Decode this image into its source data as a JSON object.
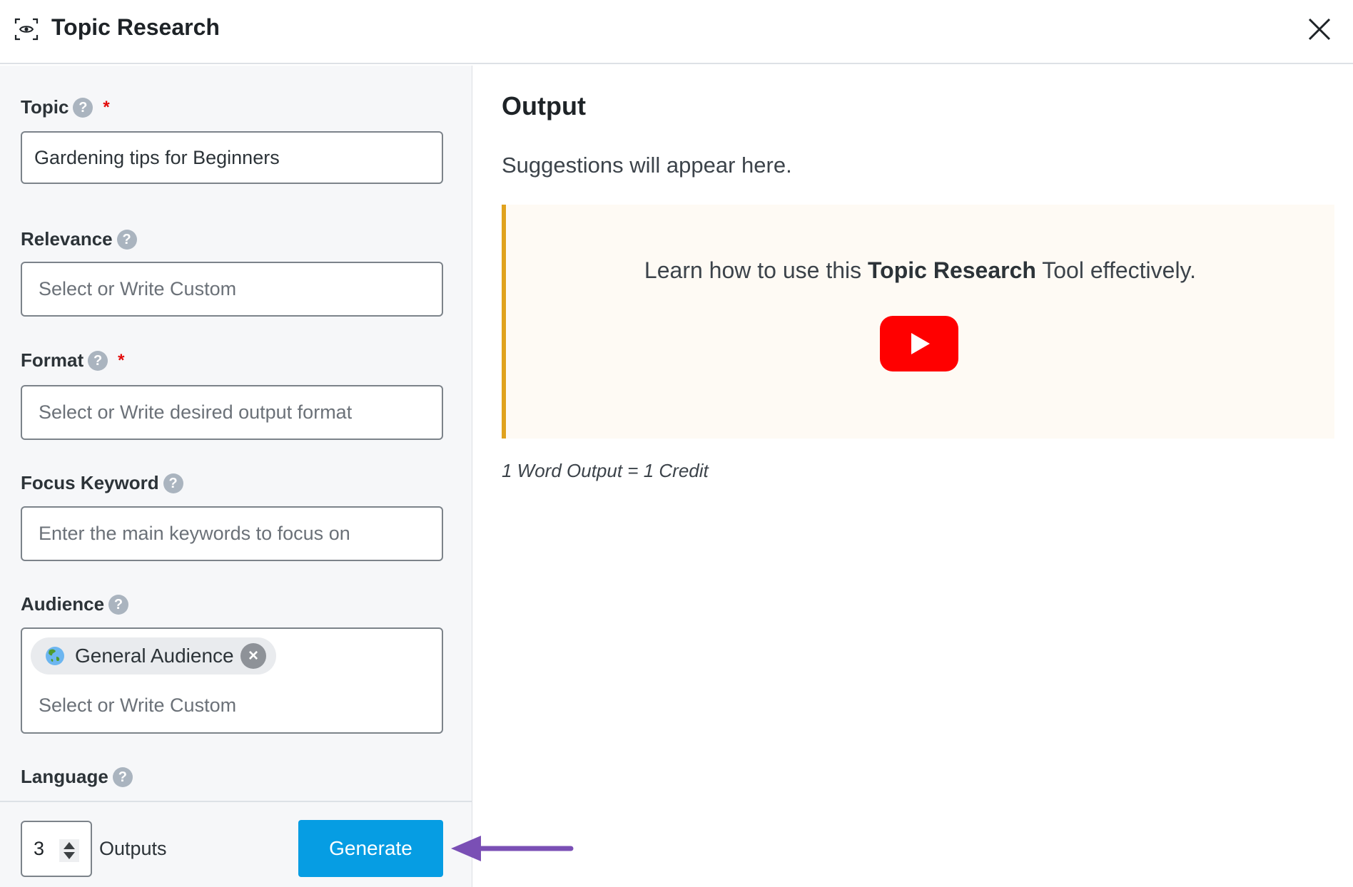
{
  "header": {
    "title": "Topic Research",
    "logo_icon": "eye-scan-icon",
    "close_icon": "close-icon"
  },
  "form": {
    "topic": {
      "label": "Topic",
      "required_mark": "*",
      "value": "Gardening tips for Beginners",
      "help": "?"
    },
    "relevance": {
      "label": "Relevance",
      "placeholder": "Select or Write Custom",
      "help": "?"
    },
    "format": {
      "label": "Format",
      "required_mark": "*",
      "placeholder": "Select or Write desired output format",
      "help": "?"
    },
    "focus_keyword": {
      "label": "Focus Keyword",
      "placeholder": "Enter the main keywords to focus on",
      "help": "?"
    },
    "audience": {
      "label": "Audience",
      "help": "?",
      "chips": [
        {
          "label": "General Audience",
          "icon": "globe-icon",
          "remove": "×"
        }
      ],
      "placeholder": "Select or Write Custom"
    },
    "language": {
      "label": "Language",
      "help": "?"
    }
  },
  "footer": {
    "outputs_value": "3",
    "outputs_label": "Outputs",
    "generate_label": "Generate"
  },
  "output": {
    "title": "Output",
    "suggestions_text": "Suggestions will appear here.",
    "callout": {
      "prefix": "Learn how to use this ",
      "bold": "Topic Research",
      "suffix": " Tool effectively.",
      "video_icon": "youtube-play-icon"
    },
    "credit_note": "1 Word Output = 1 Credit"
  },
  "colors": {
    "accent_button": "#069de3",
    "callout_border": "#e0a21d",
    "callout_bg": "#fefaf4",
    "required": "#e30b0b",
    "annotation_arrow": "#7a4fb5",
    "youtube_red": "#ff0000"
  }
}
